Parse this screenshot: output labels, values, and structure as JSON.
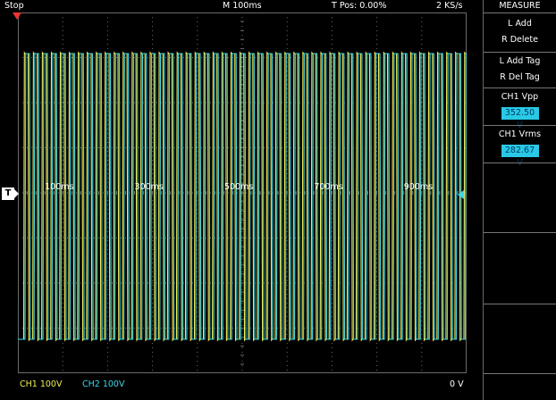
{
  "status": {
    "acq": "Stop",
    "timebase": "M 100ms",
    "trigger_pos": "T Pos: 0.00%",
    "sample_rate": "2 KS/s"
  },
  "bottom": {
    "ch1": "CH1  100V",
    "ch2": "CH2  100V",
    "trig_level": "0 V"
  },
  "plot": {
    "time_labels": [
      "100ms",
      "300ms",
      "500ms",
      "700ms",
      "900ms"
    ]
  },
  "menu": {
    "title": "MEASURE",
    "l_add": "L Add",
    "r_delete": "R Delete",
    "l_add_tag": "L Add Tag",
    "r_del_tag": "R Del Tag",
    "vpp_label": "CH1 Vpp",
    "vpp_value": "352.50 V",
    "vrms_label": "CH1 Vrms",
    "vrms_value": "282.67 V"
  },
  "colors": {
    "ch1": "#f2ef5a",
    "ch2": "#3cd8e8",
    "grid": "#6b6b6b",
    "trigger_marker": "#e33333",
    "value_bg": "#29c9e6"
  },
  "icons": {
    "trigger_position": "red-down-triangle",
    "trigger_level": "cyan-left-triangle"
  }
}
